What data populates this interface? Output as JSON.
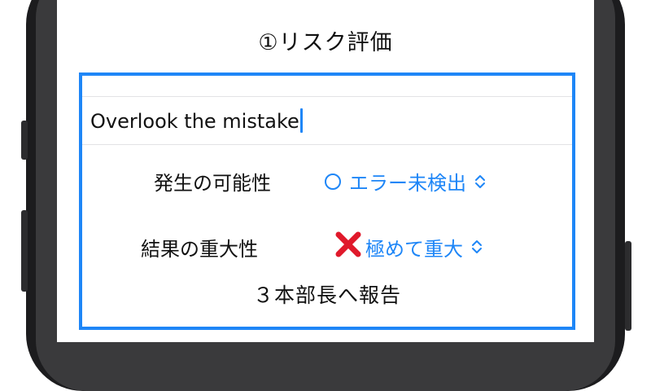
{
  "screen_title": "①リスク評価",
  "input": {
    "value": "Overlook the mistake"
  },
  "likelihood": {
    "label": "発生の可能性",
    "value": "エラー未検出",
    "icon": "circle-outline-icon",
    "color": "#1e86f7"
  },
  "impact": {
    "label": "結果の重大性",
    "value": "極めて重大",
    "icon": "red-x-icon",
    "icon_color": "#e0192b"
  },
  "result_text": "３本部長へ報告",
  "colors": {
    "accent": "#1e86f7",
    "border": "#1e86f7"
  }
}
